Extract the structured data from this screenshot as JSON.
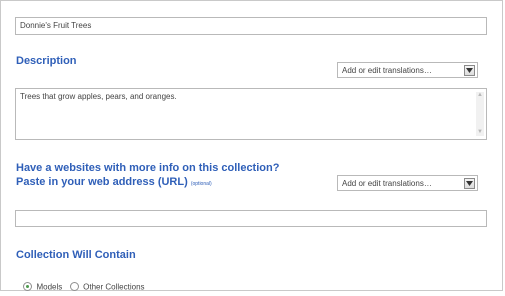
{
  "name_field": {
    "value": "Donnie's Fruit Trees"
  },
  "description": {
    "heading": "Description",
    "translation_select": "Add or edit translations…",
    "text": "Trees that grow apples, pears, and oranges."
  },
  "website": {
    "heading_line1": "Have a websites with more info on this collection?",
    "heading_line2": "Paste in your web address (URL)",
    "optional_note": "(optional)",
    "translation_select": "Add or edit translations…",
    "url_value": ""
  },
  "contents": {
    "heading": "Collection Will Contain",
    "options": [
      {
        "label": "Models",
        "selected": true
      },
      {
        "label": "Other Collections",
        "selected": false
      }
    ]
  },
  "icons": {
    "dropdown": "chevron-down-icon",
    "scroll_up": "scroll-up-icon",
    "scroll_down": "scroll-down-icon"
  }
}
